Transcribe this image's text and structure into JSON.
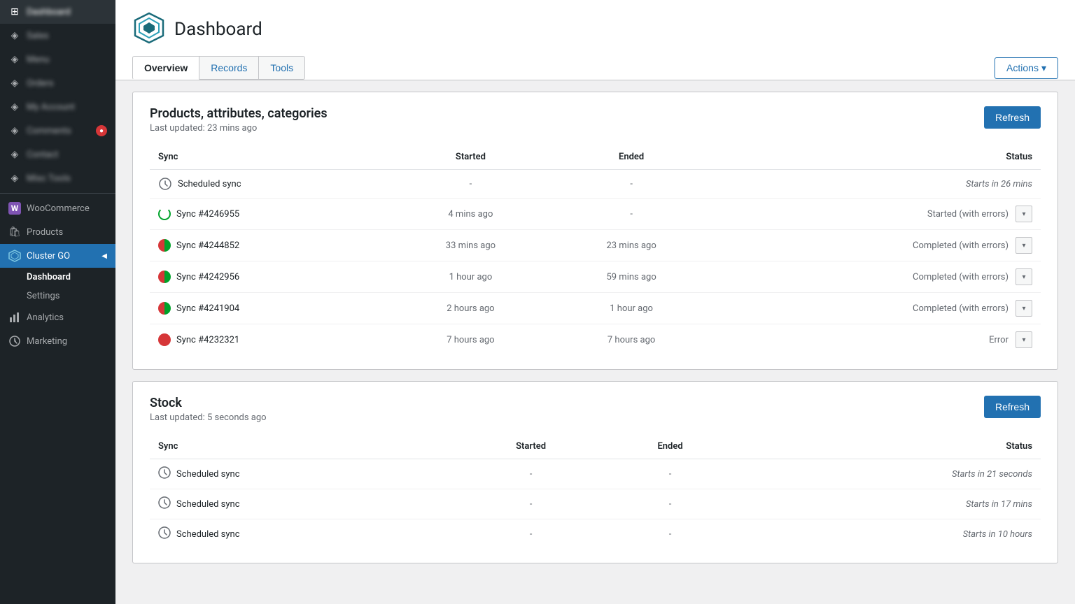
{
  "sidebar": {
    "items": [
      {
        "id": "dashboard",
        "label": "Dashboard",
        "icon": "⊞",
        "blurred": true
      },
      {
        "id": "sales",
        "label": "Sales",
        "icon": "◈",
        "blurred": true
      },
      {
        "id": "menu2",
        "label": "Menu",
        "icon": "◈",
        "blurred": true
      },
      {
        "id": "orders",
        "label": "Orders",
        "icon": "◈",
        "blurred": true
      },
      {
        "id": "my-account",
        "label": "My Account",
        "icon": "◈",
        "blurred": true
      },
      {
        "id": "comments",
        "label": "Comments",
        "icon": "◈",
        "blurred": true
      },
      {
        "id": "contact",
        "label": "Contact",
        "icon": "◈",
        "blurred": true
      },
      {
        "id": "woocommerce",
        "label": "WooCommerce",
        "icon": "woo"
      },
      {
        "id": "products",
        "label": "Products",
        "icon": "🛍"
      },
      {
        "id": "cluster-go",
        "label": "Cluster GO",
        "icon": "⊙",
        "active": true
      },
      {
        "id": "sub-dashboard",
        "label": "Dashboard",
        "sub": true,
        "active": true
      },
      {
        "id": "sub-settings",
        "label": "Settings",
        "sub": true
      },
      {
        "id": "analytics",
        "label": "Analytics",
        "icon": "📊"
      },
      {
        "id": "marketing",
        "label": "Marketing",
        "icon": "📣"
      }
    ],
    "blurred_items": [
      {
        "label": "Dashboard"
      },
      {
        "label": "Sales"
      },
      {
        "label": "Menu"
      },
      {
        "label": "Orders"
      },
      {
        "label": "My Account"
      },
      {
        "label": "Comments"
      },
      {
        "label": "Contact"
      }
    ]
  },
  "header": {
    "logo_alt": "Cluster GO logo",
    "title": "Dashboard",
    "tabs": [
      {
        "id": "overview",
        "label": "Overview",
        "active": true
      },
      {
        "id": "records",
        "label": "Records"
      },
      {
        "id": "tools",
        "label": "Tools"
      }
    ],
    "actions_label": "Actions"
  },
  "sections": [
    {
      "id": "products-attributes-categories",
      "title": "Products, attributes, categories",
      "subtitle": "Last updated: 23 mins ago",
      "refresh_label": "Refresh",
      "table": {
        "columns": [
          "Sync",
          "Started",
          "Ended",
          "Status"
        ],
        "rows": [
          {
            "id": "scheduled-1",
            "sync": "Scheduled sync",
            "icon_type": "scheduled",
            "started": "-",
            "ended": "-",
            "status": "Starts in 26 mins",
            "status_type": "scheduled",
            "has_dropdown": false
          },
          {
            "id": "sync-4246955",
            "sync": "Sync #4246955",
            "icon_type": "running",
            "started": "4 mins ago",
            "ended": "-",
            "status": "Started (with errors)",
            "status_type": "error",
            "has_dropdown": true
          },
          {
            "id": "sync-4244852",
            "sync": "Sync #4244852",
            "icon_type": "completed-error",
            "started": "33 mins ago",
            "ended": "23 mins ago",
            "status": "Completed (with errors)",
            "status_type": "error",
            "has_dropdown": true
          },
          {
            "id": "sync-4242956",
            "sync": "Sync #4242956",
            "icon_type": "completed-error",
            "started": "1 hour ago",
            "ended": "59 mins ago",
            "status": "Completed (with errors)",
            "status_type": "error",
            "has_dropdown": true
          },
          {
            "id": "sync-4241904",
            "sync": "Sync #4241904",
            "icon_type": "completed-error",
            "started": "2 hours ago",
            "ended": "1 hour ago",
            "status": "Completed (with errors)",
            "status_type": "error",
            "has_dropdown": true
          },
          {
            "id": "sync-4232321",
            "sync": "Sync #4232321",
            "icon_type": "error",
            "started": "7 hours ago",
            "ended": "7 hours ago",
            "status": "Error",
            "status_type": "error",
            "has_dropdown": true
          }
        ]
      }
    },
    {
      "id": "stock",
      "title": "Stock",
      "subtitle": "Last updated: 5 seconds ago",
      "refresh_label": "Refresh",
      "table": {
        "columns": [
          "Sync",
          "Started",
          "Ended",
          "Status"
        ],
        "rows": [
          {
            "id": "stock-scheduled-1",
            "sync": "Scheduled sync",
            "icon_type": "scheduled",
            "started": "-",
            "ended": "-",
            "status": "Starts in 21 seconds",
            "status_type": "scheduled",
            "has_dropdown": false
          },
          {
            "id": "stock-scheduled-2",
            "sync": "Scheduled sync",
            "icon_type": "scheduled",
            "started": "-",
            "ended": "-",
            "status": "Starts in 17 mins",
            "status_type": "scheduled",
            "has_dropdown": false
          },
          {
            "id": "stock-scheduled-3",
            "sync": "Scheduled sync",
            "icon_type": "scheduled",
            "started": "-",
            "ended": "-",
            "status": "Starts in 10 hours",
            "status_type": "scheduled",
            "has_dropdown": false
          }
        ]
      }
    }
  ]
}
